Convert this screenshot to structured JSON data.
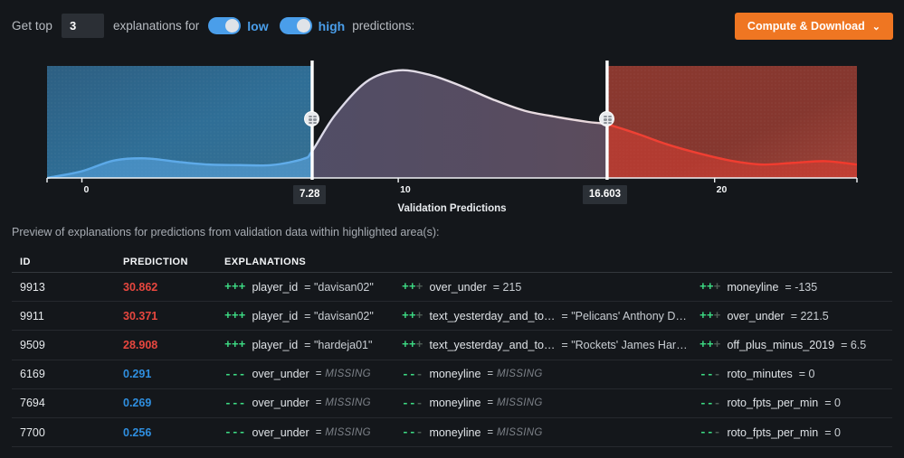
{
  "controls": {
    "label_prefix": "Get top",
    "top_n_value": "3",
    "label_mid": "explanations for",
    "toggle_low_label": "low",
    "toggle_high_label": "high",
    "label_tail": "predictions:",
    "toggle_low_state": "on",
    "toggle_high_state": "on",
    "compute_button": "Compute & Download",
    "compute_chevron": "⌄",
    "accent_orange": "#ef7622",
    "accent_blue": "#4a9eea"
  },
  "chart_data": {
    "type": "area",
    "title": "",
    "xlabel": "Validation Predictions",
    "ylabel": "",
    "xlim": [
      -1.1,
      24.5
    ],
    "ticks": [
      "0",
      "10",
      "20"
    ],
    "tick_values": [
      0,
      10,
      20
    ],
    "grid": false,
    "legend": null,
    "series": [
      {
        "name": "density",
        "x": [
          -1.1,
          0,
          1,
          2,
          3,
          4,
          5,
          6,
          7,
          7.28,
          8,
          9,
          10,
          11,
          12,
          13,
          14,
          15,
          16,
          16.603,
          17.5,
          18.5,
          19.5,
          20.5,
          21.5,
          22.5,
          23.5,
          24.5
        ],
        "y": [
          0.0,
          0.06,
          0.155,
          0.175,
          0.145,
          0.12,
          0.115,
          0.115,
          0.17,
          0.24,
          0.56,
          0.86,
          0.96,
          0.92,
          0.82,
          0.7,
          0.6,
          0.545,
          0.5,
          0.478,
          0.4,
          0.3,
          0.22,
          0.155,
          0.12,
          0.135,
          0.15,
          0.12
        ]
      }
    ],
    "brushes": [
      {
        "name": "low-region",
        "from": -1.1,
        "to": 7.28,
        "color": "#2f6e96",
        "handle_value": "7.28"
      },
      {
        "name": "high-region",
        "from": 16.603,
        "to": 24.5,
        "color": "#8c3a31",
        "handle_value": "16.603"
      }
    ],
    "handles": [
      {
        "name": "low-handle",
        "value": "7.28"
      },
      {
        "name": "high-handle",
        "value": "16.603"
      }
    ]
  },
  "table": {
    "caption": "Preview of explanations for predictions from validation data within highlighted area(s):",
    "columns": [
      "ID",
      "PREDICTION",
      "EXPLANATIONS"
    ],
    "rows": [
      {
        "id": "9913",
        "prediction": "30.862",
        "kind": "high",
        "explanations": [
          {
            "signs_on": 3,
            "signs_off": 0,
            "polarity": "+",
            "feature": "player_id",
            "value": "\"davisan02\"",
            "missing": false
          },
          {
            "signs_on": 2,
            "signs_off": 1,
            "polarity": "+",
            "feature": "over_under",
            "value": "215",
            "missing": false
          },
          {
            "signs_on": 2,
            "signs_off": 1,
            "polarity": "+",
            "feature": "moneyline",
            "value": "-135",
            "missing": false
          }
        ]
      },
      {
        "id": "9911",
        "prediction": "30.371",
        "kind": "high",
        "explanations": [
          {
            "signs_on": 3,
            "signs_off": 0,
            "polarity": "+",
            "feature": "player_id",
            "value": "\"davisan02\"",
            "missing": false
          },
          {
            "signs_on": 2,
            "signs_off": 1,
            "polarity": "+",
            "feature": "text_yesterday_and_to…",
            "value": "\"Pelicans' Anthony D…",
            "missing": false
          },
          {
            "signs_on": 2,
            "signs_off": 1,
            "polarity": "+",
            "feature": "over_under",
            "value": "221.5",
            "missing": false
          }
        ]
      },
      {
        "id": "9509",
        "prediction": "28.908",
        "kind": "high",
        "explanations": [
          {
            "signs_on": 3,
            "signs_off": 0,
            "polarity": "+",
            "feature": "player_id",
            "value": "\"hardeja01\"",
            "missing": false
          },
          {
            "signs_on": 2,
            "signs_off": 1,
            "polarity": "+",
            "feature": "text_yesterday_and_to…",
            "value": "\"Rockets' James Har…",
            "missing": false
          },
          {
            "signs_on": 2,
            "signs_off": 1,
            "polarity": "+",
            "feature": "off_plus_minus_2019",
            "value": "6.5",
            "missing": false
          }
        ]
      },
      {
        "id": "6169",
        "prediction": "0.291",
        "kind": "low",
        "explanations": [
          {
            "signs_on": 3,
            "signs_off": 0,
            "polarity": "-",
            "feature": "over_under",
            "value": "MISSING",
            "missing": true
          },
          {
            "signs_on": 2,
            "signs_off": 1,
            "polarity": "-",
            "feature": "moneyline",
            "value": "MISSING",
            "missing": true
          },
          {
            "signs_on": 2,
            "signs_off": 1,
            "polarity": "-",
            "feature": "roto_minutes",
            "value": "0",
            "missing": false
          }
        ]
      },
      {
        "id": "7694",
        "prediction": "0.269",
        "kind": "low",
        "explanations": [
          {
            "signs_on": 3,
            "signs_off": 0,
            "polarity": "-",
            "feature": "over_under",
            "value": "MISSING",
            "missing": true
          },
          {
            "signs_on": 2,
            "signs_off": 1,
            "polarity": "-",
            "feature": "moneyline",
            "value": "MISSING",
            "missing": true
          },
          {
            "signs_on": 2,
            "signs_off": 1,
            "polarity": "-",
            "feature": "roto_fpts_per_min",
            "value": "0",
            "missing": false
          }
        ]
      },
      {
        "id": "7700",
        "prediction": "0.256",
        "kind": "low",
        "explanations": [
          {
            "signs_on": 3,
            "signs_off": 0,
            "polarity": "-",
            "feature": "over_under",
            "value": "MISSING",
            "missing": true
          },
          {
            "signs_on": 2,
            "signs_off": 1,
            "polarity": "-",
            "feature": "moneyline",
            "value": "MISSING",
            "missing": true
          },
          {
            "signs_on": 2,
            "signs_off": 1,
            "polarity": "-",
            "feature": "roto_fpts_per_min",
            "value": "0",
            "missing": false
          }
        ]
      }
    ],
    "colors": {
      "high": "#e8473f",
      "low": "#2f8fe0",
      "sign_on": "#3ddc84",
      "sign_off": "#4e5d55"
    }
  }
}
